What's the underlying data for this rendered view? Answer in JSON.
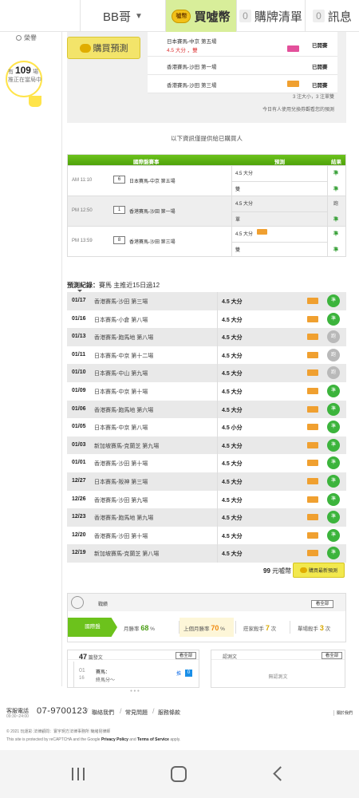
{
  "topbar": {
    "user": "BB哥",
    "buy_coins": "買噓幣",
    "cart_label": "購牌清單",
    "cart_count": "0",
    "msg_label": "訊息",
    "msg_count": "0",
    "coin_text": "噓幣"
  },
  "left": {
    "sub_label": "榮譽",
    "hit_count": "109",
    "hit_unit": "場",
    "hit_text1": "有",
    "hit_text2": "推正在當局中"
  },
  "prediction": {
    "buy_label": "購買預測",
    "items": [
      {
        "name": "日本賽馬-中京 第五場",
        "sub": "4.5 大分 ，雙",
        "result": "已開賽",
        "tag": "pink"
      },
      {
        "name": "香港賽馬-沙田 第一場",
        "sub": "",
        "result": "已開賽",
        "tag": ""
      },
      {
        "name": "香港賽馬-沙田 第三場",
        "sub": "",
        "result": "已開賽",
        "tag": "orange"
      }
    ],
    "note": "3 注大小，3 注單雙",
    "note2": "今日有人使用兌換券觀看您的預測"
  },
  "info_note": "以下資訊僅提供給已購買人",
  "game_table": {
    "headers": [
      "國際盤賽事",
      "預測",
      "結果"
    ],
    "rows": [
      {
        "time": "AM 11:10",
        "num": "6",
        "name": "日本賽馬-中京 第五場",
        "p1": "4.5 大分",
        "p2": "雙",
        "r1": "準",
        "r2": "準",
        "tag": false
      },
      {
        "time": "PM 12:50",
        "num": "1",
        "name": "香港賽馬-沙田 第一場",
        "p1": "4.5 大分",
        "p2": "單",
        "r1": "跑",
        "r2": "準",
        "tag": false
      },
      {
        "time": "PM 13:59",
        "num": "8",
        "name": "香港賽馬-沙田 第三場",
        "p1": "4.5 大分",
        "p2": "雙",
        "r1": "準",
        "r2": "準",
        "tag": true
      }
    ]
  },
  "record": {
    "title_bold": "預測紀錄：",
    "title_rest": "賽馬 主推近15日過12",
    "rows": [
      {
        "date": "01/17",
        "game": "香港賽馬-沙田 第三場",
        "pred": "4.5 大分",
        "res": "準",
        "win": true
      },
      {
        "date": "01/16",
        "game": "日本賽馬-小倉 第八場",
        "pred": "4.5 大分",
        "res": "準",
        "win": true
      },
      {
        "date": "01/13",
        "game": "香港賽馬-跑馬地 第八場",
        "pred": "4.5 大分",
        "res": "跑",
        "win": false
      },
      {
        "date": "01/11",
        "game": "日本賽馬-中京 第十二場",
        "pred": "4.5 大分",
        "res": "跑",
        "win": false
      },
      {
        "date": "01/10",
        "game": "日本賽馬-中山 第九場",
        "pred": "4.5 大分",
        "res": "跑",
        "win": false
      },
      {
        "date": "01/09",
        "game": "日本賽馬-中京 第十場",
        "pred": "4.5 大分",
        "res": "準",
        "win": true
      },
      {
        "date": "01/06",
        "game": "香港賽馬-跑馬地 第六場",
        "pred": "4.5 大分",
        "res": "準",
        "win": true
      },
      {
        "date": "01/05",
        "game": "日本賽馬-中京 第八場",
        "pred": "4.5 小分",
        "res": "準",
        "win": true
      },
      {
        "date": "01/03",
        "game": "新加坡賽馬-克蘭芝 第九場",
        "pred": "4.5 大分",
        "res": "準",
        "win": true
      },
      {
        "date": "01/01",
        "game": "香港賽馬-沙田 第十場",
        "pred": "4.5 大分",
        "res": "準",
        "win": true
      },
      {
        "date": "12/27",
        "game": "日本賽馬-阪神 第三場",
        "pred": "4.5 大分",
        "res": "準",
        "win": true
      },
      {
        "date": "12/26",
        "game": "香港賽馬-沙田 第九場",
        "pred": "4.5 大分",
        "res": "準",
        "win": true
      },
      {
        "date": "12/23",
        "game": "香港賽馬-跑馬地 第九場",
        "pred": "4.5 大分",
        "res": "準",
        "win": true
      },
      {
        "date": "12/20",
        "game": "香港賽馬-沙田 第十場",
        "pred": "4.5 大分",
        "res": "準",
        "win": true
      },
      {
        "date": "12/19",
        "game": "新加坡賽馬-克蘭芝 第八場",
        "pred": "4.5 大分",
        "res": "準",
        "win": true
      }
    ]
  },
  "price": {
    "amount": "99",
    "unit": "元噓幣",
    "buy_latest": "購買最新預測"
  },
  "stats": {
    "title": "戰績",
    "more": "看全部",
    "tab": "國際盤",
    "month_label": "月勝率",
    "month_val": "68",
    "month_unit": "%",
    "lastmonth_label": "上個月勝率",
    "lastmonth_val": "70",
    "lastmonth_unit": "%",
    "streak_label": "莊家殺手",
    "streak_val": "7",
    "streak_unit": "次",
    "single_label": "單場殺手",
    "single_val": "3",
    "single_unit": "次"
  },
  "posts": {
    "count": "47",
    "label": "篇發文",
    "more": "看全部",
    "line1": "01",
    "line2": "賽馬：",
    "line3": "16",
    "line4": "終馬分～",
    "tag": "推",
    "badge": "0"
  },
  "draft": {
    "label": "認測文",
    "more": "看全部",
    "empty": "無認測文"
  },
  "footer": {
    "phone_label": "客服電話",
    "hours": "09:30~24:00",
    "phone": "07-9700123",
    "links": [
      "聯絡我們",
      "常見問題",
      "服務條款"
    ],
    "about": "關於我們",
    "copy": "© 2021 玩運彩 法律顧問：寰宇玥方法律事務所 簡緒昆律師",
    "recap_pre": "This site is protected by reCAPTCHA and the Google",
    "privacy": "Privacy Policy",
    "and": "and",
    "terms": "Terms of Service",
    "apply": "apply."
  }
}
